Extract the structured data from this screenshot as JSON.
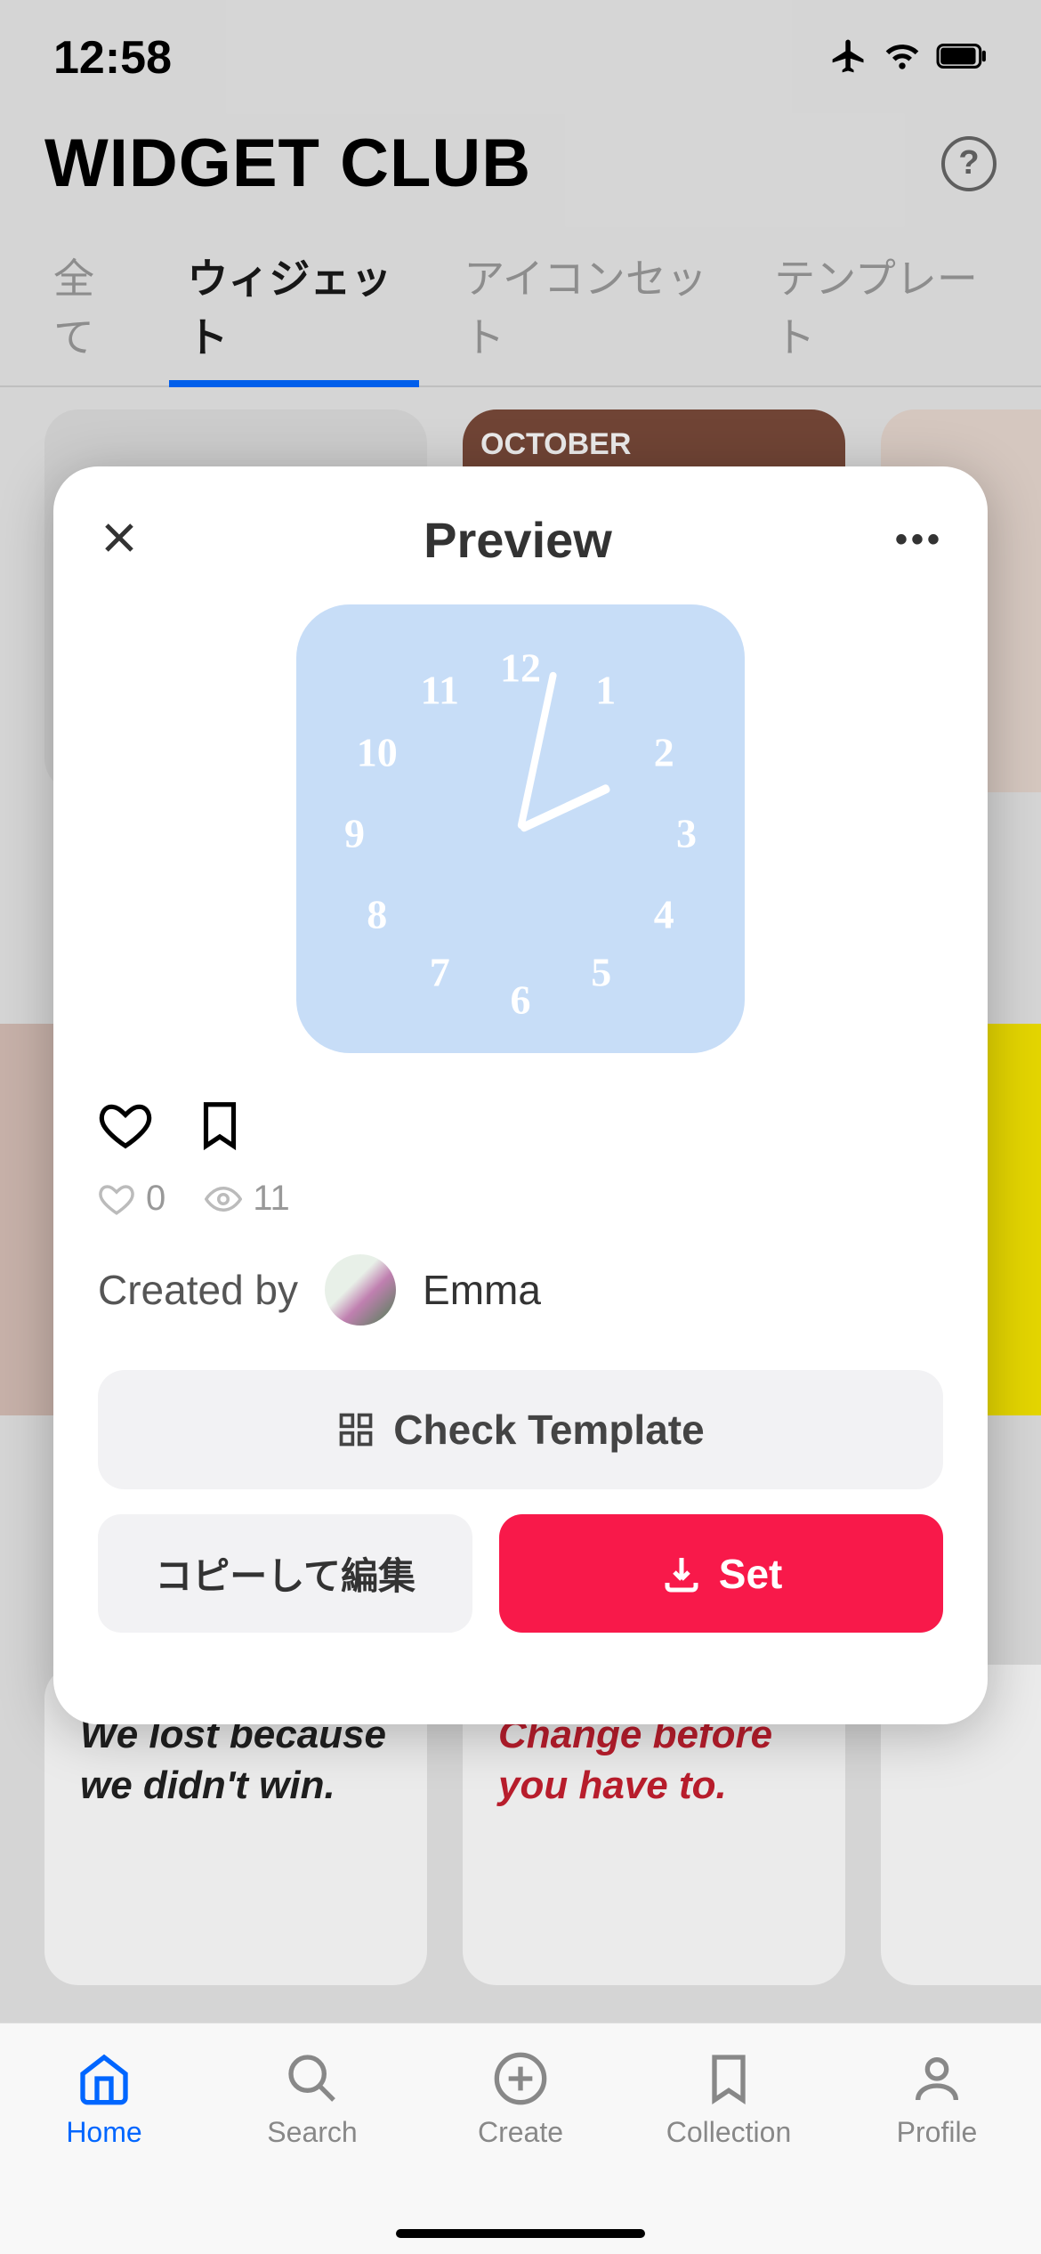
{
  "status": {
    "time": "12:58"
  },
  "header": {
    "title": "WIDGET CLUB",
    "help": "?"
  },
  "tabs": [
    {
      "label": "全て",
      "active": false
    },
    {
      "label": "ウィジェット",
      "active": true
    },
    {
      "label": "アイコンセット",
      "active": false
    },
    {
      "label": "テンプレート",
      "active": false
    }
  ],
  "bg": {
    "october": "OCTOBER",
    "quote1": "We lost because we didn't win.",
    "quote2": "Change before you have to."
  },
  "modal": {
    "title": "Preview",
    "clock_numbers": [
      "12",
      "1",
      "2",
      "3",
      "4",
      "5",
      "6",
      "7",
      "8",
      "9",
      "10",
      "11"
    ],
    "likes": "0",
    "views": "11",
    "created_by_label": "Created by",
    "creator_name": "Emma",
    "check_template": "Check Template",
    "copy_edit": "コピーして編集",
    "set": "Set"
  },
  "nav": {
    "home": "Home",
    "search": "Search",
    "create": "Create",
    "collection": "Collection",
    "profile": "Profile"
  }
}
